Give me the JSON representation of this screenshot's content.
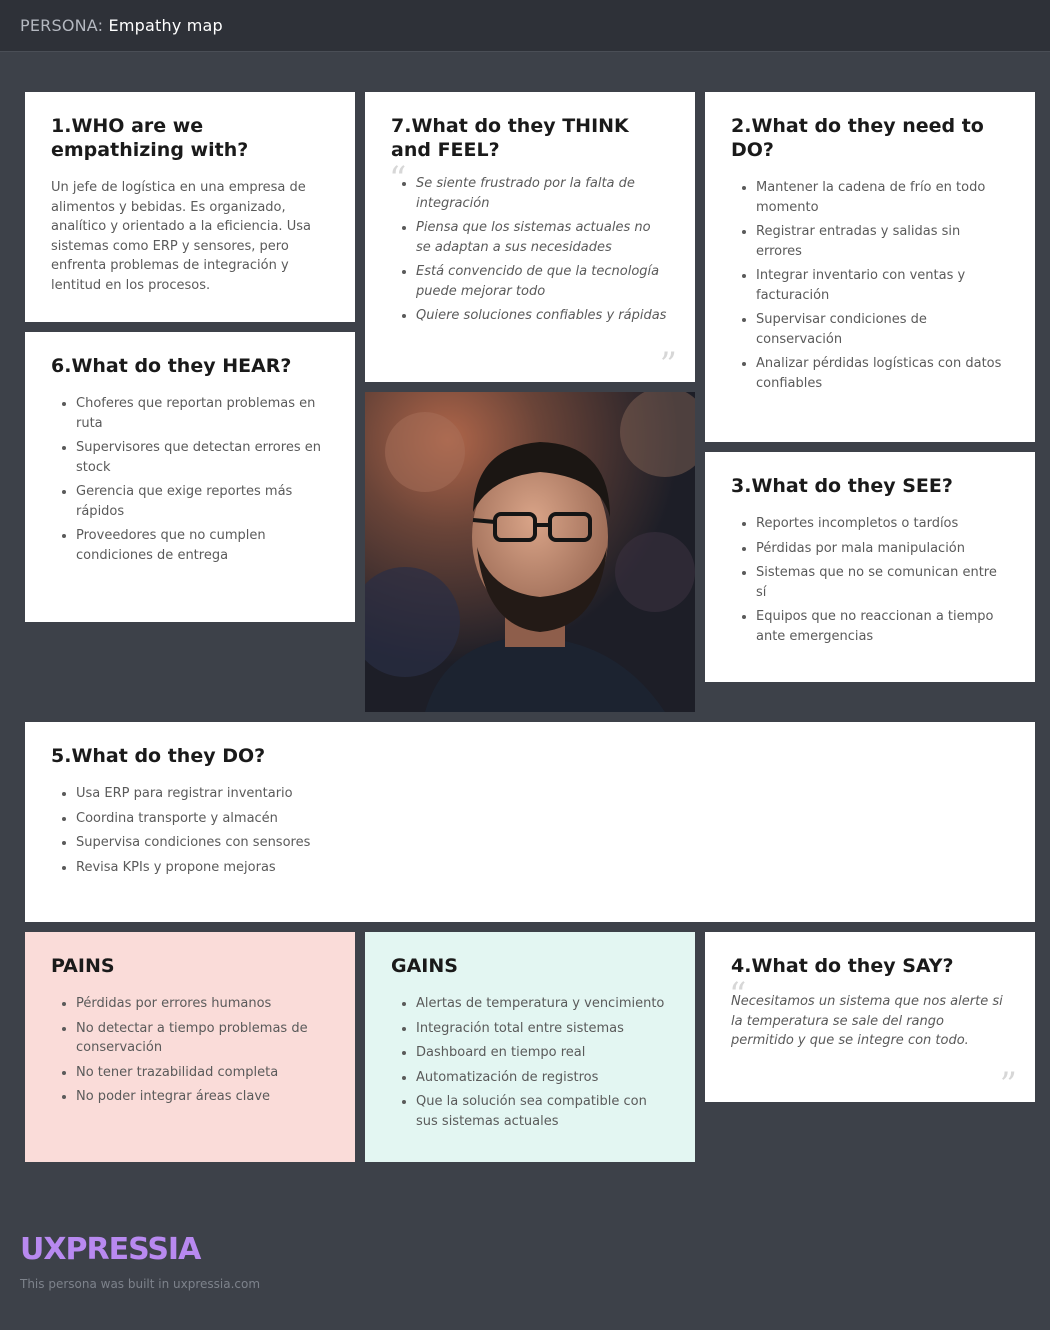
{
  "header": {
    "prefix": "PERSONA:",
    "title": "Empathy map"
  },
  "who": {
    "title": "1.WHO are we empathizing with?",
    "text": "Un jefe de logística en una empresa de alimentos y bebidas. Es organizado, analítico y orientado a la eficiencia. Usa sistemas como ERP y sensores, pero enfrenta problemas de integración y lentitud en los procesos."
  },
  "think": {
    "title": "7.What do they THINK and FEEL?",
    "items": [
      "Se siente frustrado por la falta de integración",
      "Piensa que los sistemas actuales no se adaptan a sus necesidades",
      "Está convencido de que la tecnología puede mejorar todo",
      "Quiere soluciones confiables y rápidas"
    ]
  },
  "need": {
    "title": "2.What do they need to DO?",
    "items": [
      "Mantener la cadena de frío en todo momento",
      "Registrar entradas y salidas sin errores",
      "Integrar inventario con ventas y facturación",
      "Supervisar condiciones de conservación",
      "Analizar pérdidas logísticas con datos confiables"
    ]
  },
  "hear": {
    "title": "6.What do they HEAR?",
    "items": [
      "Choferes que reportan problemas en ruta",
      "Supervisores que detectan errores en stock",
      "Gerencia que exige reportes más rápidos",
      "Proveedores que no cumplen condiciones de entrega"
    ]
  },
  "see": {
    "title": "3.What do they SEE?",
    "items": [
      "Reportes incompletos o tardíos",
      "Pérdidas por mala manipulación",
      "Sistemas que no se comunican entre sí",
      "Equipos que no reaccionan a tiempo ante emergencias"
    ]
  },
  "do": {
    "title": "5.What do they DO?",
    "items": [
      "Usa ERP para registrar inventario",
      "Coordina transporte y almacén",
      "Supervisa condiciones con sensores",
      "Revisa KPIs y propone mejoras"
    ]
  },
  "pains": {
    "title": "PAINS",
    "items": [
      "Pérdidas por errores humanos",
      "No detectar a tiempo problemas de conservación",
      "No tener trazabilidad completa",
      "No poder integrar áreas clave"
    ]
  },
  "gains": {
    "title": "GAINS",
    "items": [
      "Alertas de temperatura y vencimiento",
      "Integración total entre sistemas",
      "Dashboard en tiempo real",
      "Automatización de registros",
      "Que la solución sea compatible con sus sistemas actuales"
    ]
  },
  "say": {
    "title": "4.What do they SAY?",
    "quote": "Necesitamos un sistema que nos alerte si la temperatura se sale del rango permitido y que se integre con todo."
  },
  "footer": {
    "logo": "UXPRESSIA",
    "note": "This persona was built in uxpressia.com"
  },
  "colors": {
    "background": "#3d4149",
    "pains": "#fadcd9",
    "gains": "#e3f6f2",
    "logo": "#b889f0"
  }
}
